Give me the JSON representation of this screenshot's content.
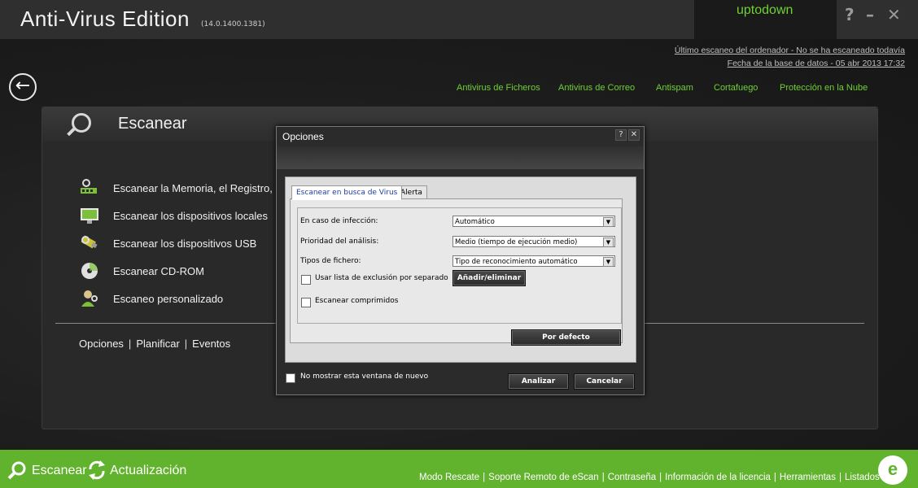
{
  "app": {
    "title": "Anti-Virus Edition",
    "version": "(14.0.1400.1381)",
    "brand": "uptodown",
    "help_label": "?",
    "minimize_label": "–",
    "close_label": "✕"
  },
  "status": {
    "last_scan": "Último escaneo del ordenador - No se ha escaneado todavía",
    "db_date": "Fecha de la base de datos - 05 abr 2013 17:32"
  },
  "modules": [
    "Antivirus de Ficheros",
    "Antivirus de Correo",
    "Antispam",
    "Cortafuego",
    "Protección en la Nube"
  ],
  "scan_panel": {
    "title": "Escanear",
    "items": [
      {
        "label": "Escanear la Memoria, el Registro, los",
        "icon": "memory-scan-icon"
      },
      {
        "label": "Escanear los dispositivos locales",
        "icon": "local-devices-icon"
      },
      {
        "label": "Escanear los dispositivos USB",
        "icon": "usb-icon"
      },
      {
        "label": "Escanear CD-ROM",
        "icon": "cdrom-icon"
      },
      {
        "label": "Escaneo personalizado",
        "icon": "custom-scan-icon"
      }
    ],
    "links": [
      "Opciones",
      "Planificar",
      "Eventos"
    ]
  },
  "dialog": {
    "title": "Opciones",
    "help": "?",
    "close": "✕",
    "tabs": [
      "Escanear en busca de Virus",
      "Alerta"
    ],
    "fields": [
      {
        "label": "En caso de infección:",
        "value": "Automático"
      },
      {
        "label": "Prioridad del análisis:",
        "value": "Medio (tiempo de ejecución medio)"
      },
      {
        "label": "Tipos de fichero:",
        "value": "Tipo de reconocimiento automático"
      }
    ],
    "exclusion_label": "Usar lista de exclusión por separado",
    "add_remove_label": "Añadir/eliminar",
    "compressed_label": "Escanear comprimidos",
    "default_label": "Por defecto",
    "dont_show_label": "No mostrar esta ventana de nuevo",
    "analyze_label": "Analizar",
    "cancel_label": "Cancelar"
  },
  "footer": {
    "scan_label": "Escanear",
    "update_label": "Actualización",
    "links": [
      "Modo Rescate",
      "Soporte Remoto de eScan",
      "Contraseña",
      "Información de la licencia",
      "Herramientas",
      "Listados"
    ],
    "logo_text": "e"
  },
  "colors": {
    "accent": "#6fd132",
    "footer_bg": "#61b22d"
  }
}
